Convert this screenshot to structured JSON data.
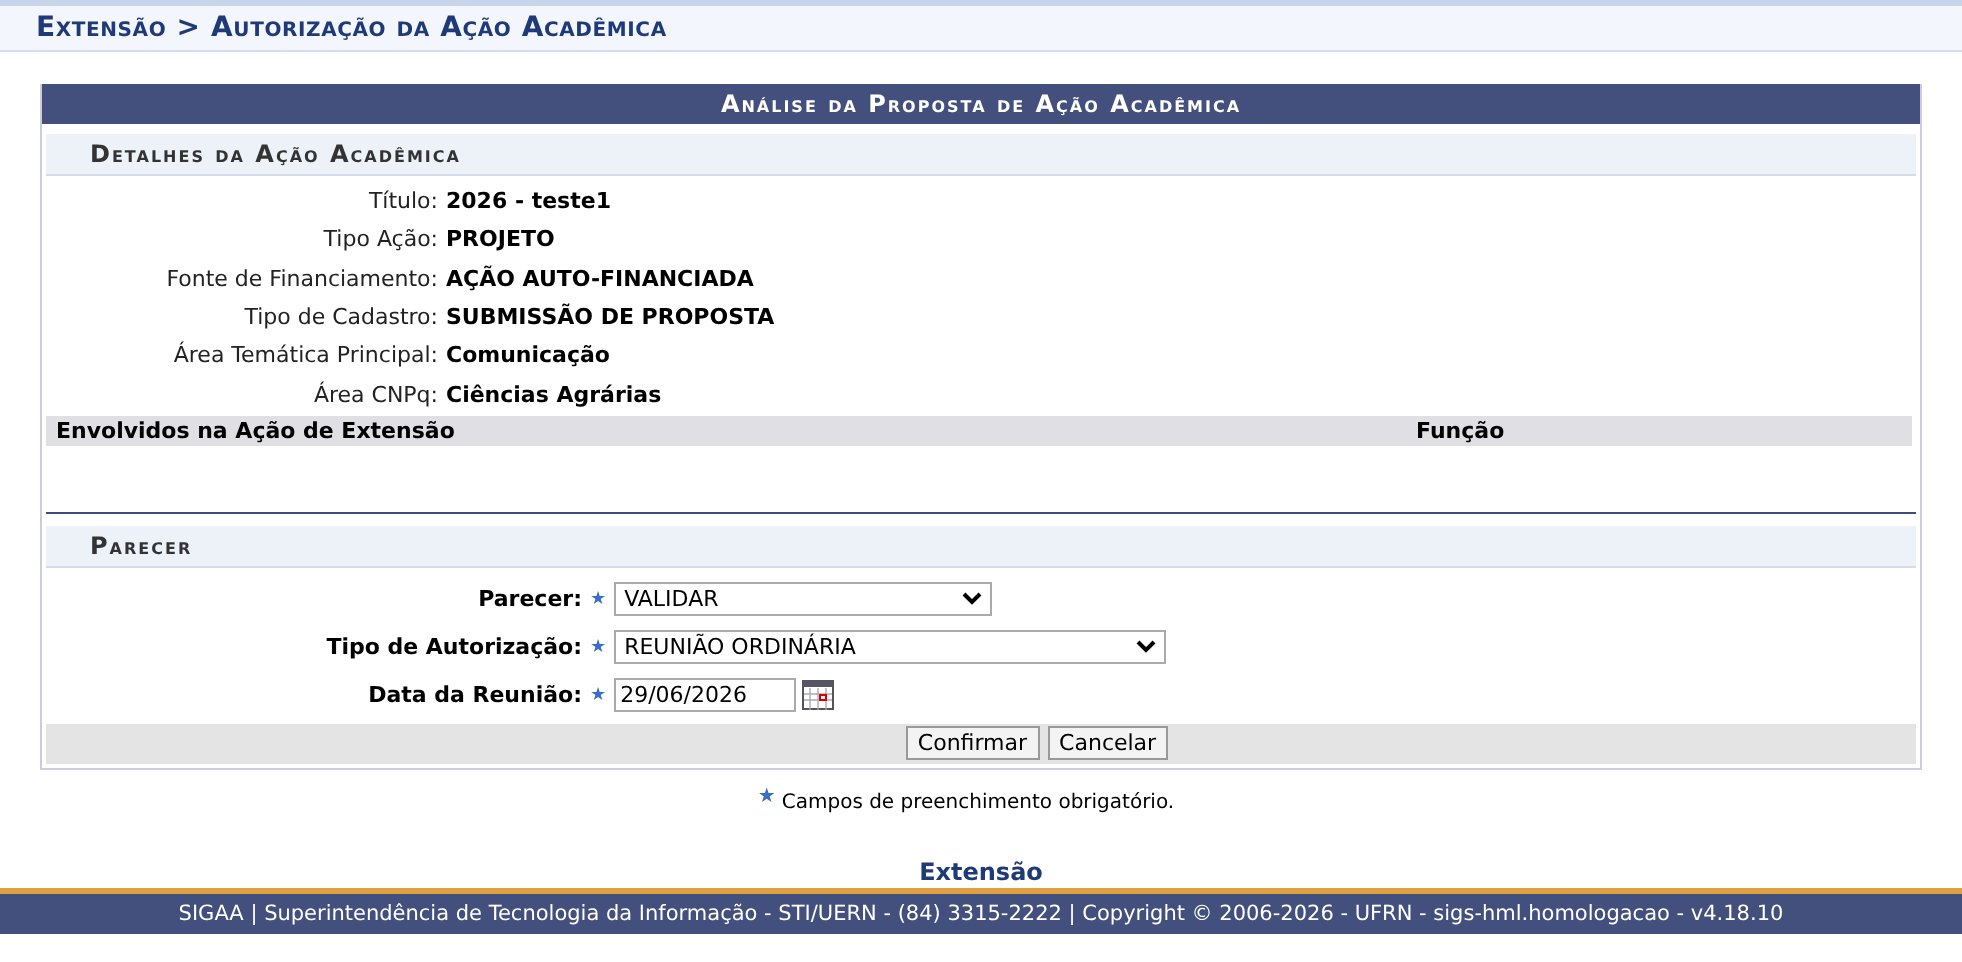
{
  "breadcrumb": "Extensão > Autorização da Ação Acadêmica",
  "panel": {
    "title": "Análise da Proposta de Ação Acadêmica",
    "details": {
      "title": "Detalhes da Ação Acadêmica",
      "fields": [
        {
          "label": "Título:",
          "value": "2026 - teste1"
        },
        {
          "label": "Tipo Ação:",
          "value": "PROJETO"
        },
        {
          "label": "Fonte de Financiamento:",
          "value": "AÇÃO AUTO-FINANCIADA"
        },
        {
          "label": "Tipo de Cadastro:",
          "value": "SUBMISSÃO DE PROPOSTA"
        },
        {
          "label": "Área Temática Principal:",
          "value": "Comunicação"
        },
        {
          "label": "Área CNPq:",
          "value": "Ciências Agrárias"
        }
      ]
    },
    "members_table": {
      "columns": [
        "Envolvidos na Ação de Extensão",
        "Função"
      ]
    },
    "opinion": {
      "title": "Parecer",
      "fields": [
        {
          "kind": "select",
          "label": "Parecer:",
          "required_mark": "★",
          "value": "VALIDAR"
        },
        {
          "kind": "select",
          "label": "Tipo de Autorização:",
          "required_mark": "★",
          "value": "REUNIÃO ORDINÁRIA"
        },
        {
          "kind": "date",
          "label": "Data da Reunião:",
          "required_mark": "★",
          "value": "29/06/2026"
        }
      ]
    },
    "buttons": [
      "Confirmar",
      "Cancelar"
    ]
  },
  "required_note": {
    "mark": "★",
    "text": "Campos de preenchimento obrigatório."
  },
  "footer": {
    "link": "Extensão",
    "text": "SIGAA | Superintendência de Tecnologia da Informação - STI/UERN - (84) 3315-2222 | Copyright © 2006-2026 - UFRN - sigs-hml.homologacao - v4.18.10"
  }
}
